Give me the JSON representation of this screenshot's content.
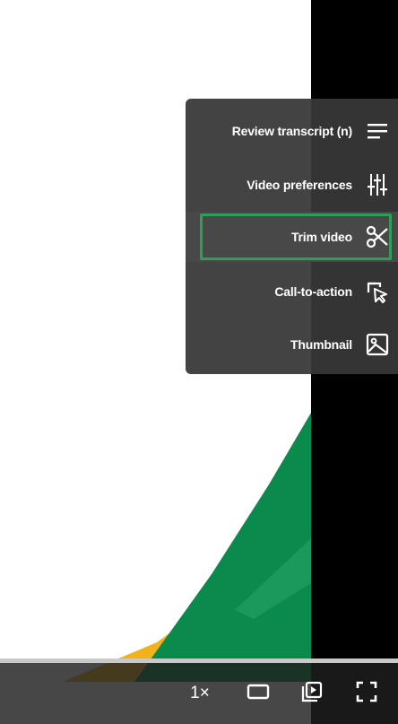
{
  "menu": {
    "items": [
      {
        "label": "Review transcript (n)",
        "icon": "transcript-lines-icon"
      },
      {
        "label": "Video preferences",
        "icon": "sliders-icon"
      },
      {
        "label": "Trim video",
        "icon": "scissors-icon",
        "active": true
      },
      {
        "label": "Call-to-action",
        "icon": "cursor-click-icon"
      },
      {
        "label": "Thumbnail",
        "icon": "image-icon"
      }
    ]
  },
  "controls": {
    "speed_label": "1×",
    "theater_icon": "theater-mode-icon",
    "playlist_icon": "playlist-play-icon",
    "fullscreen_icon": "fullscreen-icon"
  },
  "colors": {
    "focus_ring": "#2e9e58",
    "menu_bg": "#373737",
    "video_black": "#000000",
    "shape_green": "#0b8a4e",
    "shape_yellow": "#f2b21c"
  }
}
